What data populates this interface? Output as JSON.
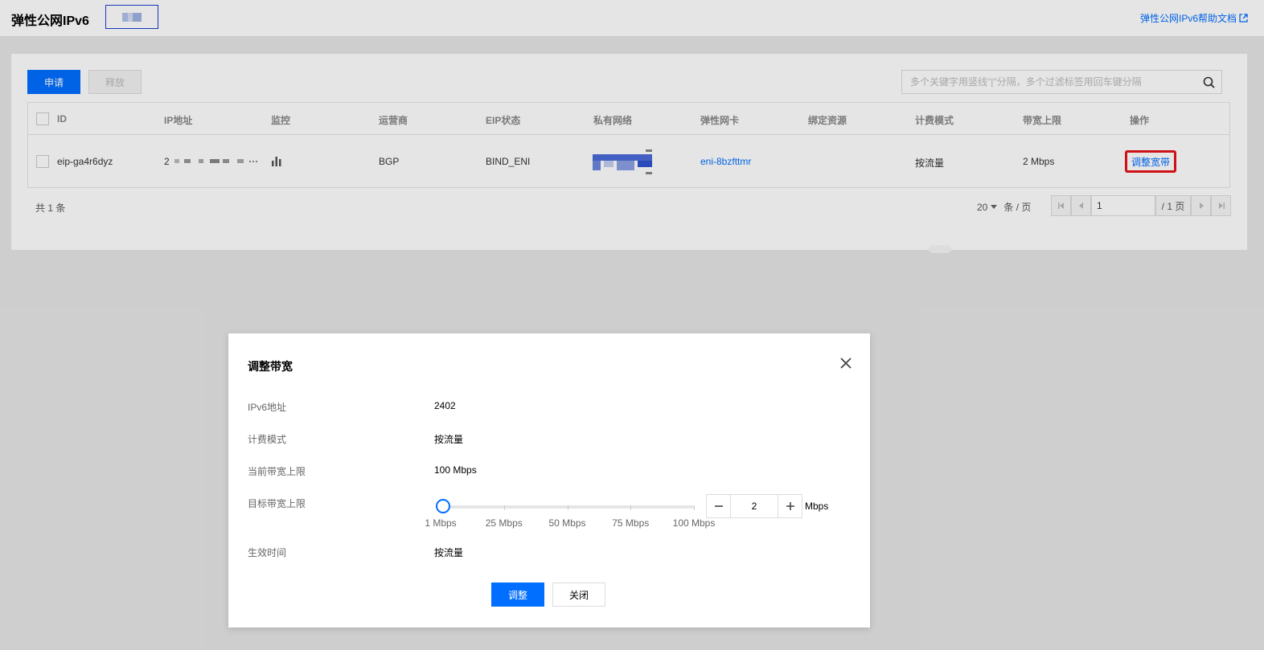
{
  "header": {
    "title": "弹性公网IPv6",
    "help_link": "弹性公网IPv6帮助文档"
  },
  "toolbar": {
    "apply_label": "申请",
    "release_label": "释放",
    "search_placeholder": "多个关键字用竖线\"|\"分隔，多个过滤标签用回车键分隔"
  },
  "table": {
    "columns": [
      "ID",
      "IP地址",
      "监控",
      "运营商",
      "EIP状态",
      "私有网络",
      "弹性网卡",
      "绑定资源",
      "计费模式",
      "带宽上限",
      "操作"
    ],
    "rows": [
      {
        "id": "eip-ga4r6dyz",
        "ip_prefix": "2",
        "isp": "BGP",
        "status": "BIND_ENI",
        "eni": "eni-8bzfttmr",
        "billing": "按流量",
        "bandwidth": "2 Mbps",
        "action": "调整宽带"
      }
    ]
  },
  "footer": {
    "total": "共 1 条",
    "page_size": "20",
    "page_size_unit": "条 / 页",
    "current_page": "1",
    "total_pages": "/ 1 页"
  },
  "dialog": {
    "title": "调整带宽",
    "fields": {
      "ipv6_label": "IPv6地址",
      "ipv6_value": "2402",
      "billing_label": "计费模式",
      "billing_value": "按流量",
      "current_label": "当前带宽上限",
      "current_value": "100 Mbps",
      "target_label": "目标带宽上限",
      "effective_label": "生效时间",
      "effective_value": "按流量"
    },
    "slider": {
      "min": 1,
      "max": 100,
      "value": 2,
      "marks": [
        "1 Mbps",
        "25 Mbps",
        "50 Mbps",
        "75 Mbps",
        "100 Mbps"
      ]
    },
    "stepper_value": "2",
    "unit": "Mbps",
    "ok_label": "调整",
    "cancel_label": "关闭"
  },
  "colors": {
    "primary": "#006eff",
    "highlight": "#e5141a"
  }
}
